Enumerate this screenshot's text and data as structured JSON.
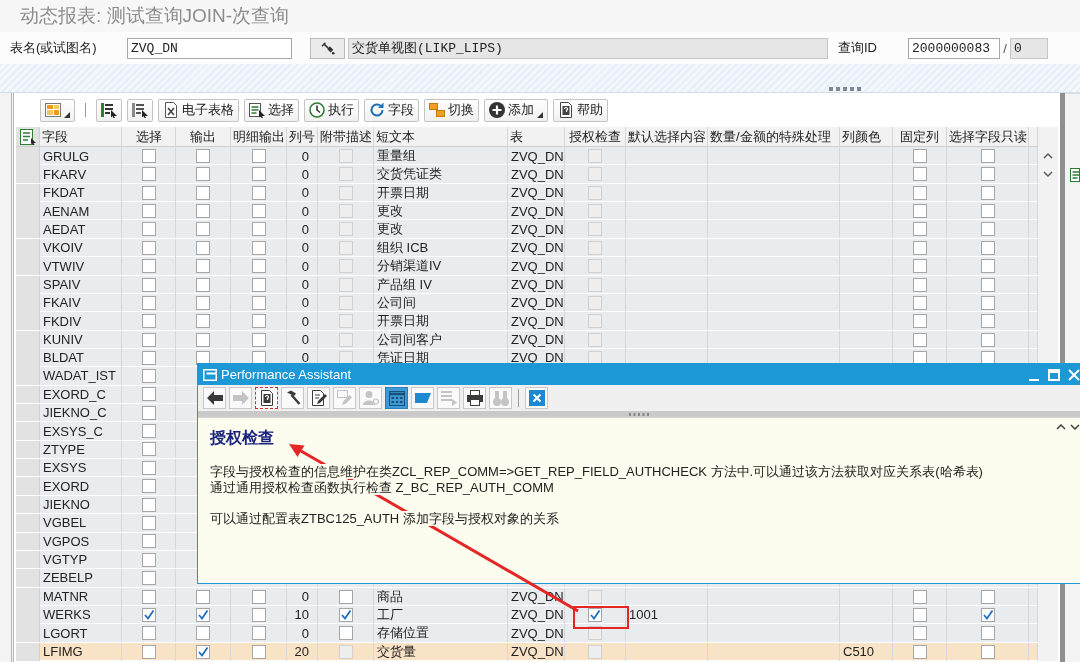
{
  "page_title": "动态报表: 测试查询JOIN-次查询",
  "header_fields": {
    "table_name": {
      "label": "表名(或试图名)",
      "value": "ZVQ_DN"
    },
    "table_description": "交货单视图(LIKP_LIPS)",
    "query_id": {
      "label": "查询ID",
      "value": "2000000083",
      "separator": "/",
      "sub_value": "0"
    }
  },
  "toolbar": [
    {
      "kind": "button",
      "menu": true
    },
    {
      "kind": "separator"
    },
    {
      "kind": "button",
      "menu": false
    },
    {
      "kind": "button",
      "menu": false
    },
    {
      "kind": "button",
      "label": "电子表格",
      "menu": false
    },
    {
      "kind": "button",
      "label": "选择",
      "menu": false
    },
    {
      "kind": "button",
      "label": "执行",
      "menu": false
    },
    {
      "kind": "button",
      "label": "字段",
      "menu": false
    },
    {
      "kind": "button",
      "label": "切换",
      "menu": false
    },
    {
      "kind": "button",
      "label": "添加",
      "menu": true
    },
    {
      "kind": "button",
      "label": "帮助",
      "menu": false
    }
  ],
  "table": {
    "columns": [
      {
        "label": "字段",
        "kind": "text"
      },
      {
        "label": "选择",
        "kind": "check"
      },
      {
        "label": "输出",
        "kind": "check"
      },
      {
        "label": "明细输出",
        "kind": "check"
      },
      {
        "label": "列号",
        "kind": "number"
      },
      {
        "label": "附带描述",
        "kind": "check"
      },
      {
        "label": "短文本",
        "kind": "text"
      },
      {
        "label": "表",
        "kind": "text"
      },
      {
        "label": "授权检查",
        "kind": "check"
      },
      {
        "label": "默认选择内容",
        "kind": "text"
      },
      {
        "label": "数量/金额的特殊处理",
        "kind": "text"
      },
      {
        "label": "列颜色",
        "kind": "text"
      },
      {
        "label": "固定列",
        "kind": "check"
      },
      {
        "label": "选择字段只读",
        "kind": "check"
      }
    ],
    "rows": [
      {
        "highlighted": false,
        "cells": [
          "GRULG",
          {
            "checked": false,
            "disabled": false
          },
          {
            "checked": false,
            "disabled": false
          },
          {
            "checked": false,
            "disabled": false
          },
          "0",
          {
            "checked": false,
            "disabled": true
          },
          "重量组",
          "ZVQ_DN",
          {
            "checked": false,
            "disabled": true
          },
          null,
          null,
          null,
          {
            "checked": false,
            "disabled": false
          },
          {
            "checked": false,
            "disabled": false
          }
        ]
      },
      {
        "highlighted": false,
        "cells": [
          "FKARV",
          {
            "checked": false,
            "disabled": false
          },
          {
            "checked": false,
            "disabled": false
          },
          {
            "checked": false,
            "disabled": false
          },
          "0",
          {
            "checked": false,
            "disabled": true
          },
          "交货凭证类",
          "ZVQ_DN",
          {
            "checked": false,
            "disabled": true
          },
          null,
          null,
          null,
          {
            "checked": false,
            "disabled": false
          },
          {
            "checked": false,
            "disabled": false
          }
        ]
      },
      {
        "highlighted": false,
        "cells": [
          "FKDAT",
          {
            "checked": false,
            "disabled": false
          },
          {
            "checked": false,
            "disabled": false
          },
          {
            "checked": false,
            "disabled": false
          },
          "0",
          {
            "checked": false,
            "disabled": true
          },
          "开票日期",
          "ZVQ_DN",
          {
            "checked": false,
            "disabled": true
          },
          null,
          null,
          null,
          {
            "checked": false,
            "disabled": false
          },
          {
            "checked": false,
            "disabled": false
          }
        ]
      },
      {
        "highlighted": false,
        "cells": [
          "AENAM",
          {
            "checked": false,
            "disabled": false
          },
          {
            "checked": false,
            "disabled": false
          },
          {
            "checked": false,
            "disabled": false
          },
          "0",
          {
            "checked": false,
            "disabled": true
          },
          "更改",
          "ZVQ_DN",
          {
            "checked": false,
            "disabled": true
          },
          null,
          null,
          null,
          {
            "checked": false,
            "disabled": false
          },
          {
            "checked": false,
            "disabled": false
          }
        ]
      },
      {
        "highlighted": false,
        "cells": [
          "AEDAT",
          {
            "checked": false,
            "disabled": false
          },
          {
            "checked": false,
            "disabled": false
          },
          {
            "checked": false,
            "disabled": false
          },
          "0",
          {
            "checked": false,
            "disabled": true
          },
          "更改",
          "ZVQ_DN",
          {
            "checked": false,
            "disabled": true
          },
          null,
          null,
          null,
          {
            "checked": false,
            "disabled": false
          },
          {
            "checked": false,
            "disabled": false
          }
        ]
      },
      {
        "highlighted": false,
        "cells": [
          "VKOIV",
          {
            "checked": false,
            "disabled": false
          },
          {
            "checked": false,
            "disabled": false
          },
          {
            "checked": false,
            "disabled": false
          },
          "0",
          {
            "checked": false,
            "disabled": true
          },
          "组织 ICB",
          "ZVQ_DN",
          {
            "checked": false,
            "disabled": true
          },
          null,
          null,
          null,
          {
            "checked": false,
            "disabled": false
          },
          {
            "checked": false,
            "disabled": false
          }
        ]
      },
      {
        "highlighted": false,
        "cells": [
          "VTWIV",
          {
            "checked": false,
            "disabled": false
          },
          {
            "checked": false,
            "disabled": false
          },
          {
            "checked": false,
            "disabled": false
          },
          "0",
          {
            "checked": false,
            "disabled": true
          },
          "分销渠道IV",
          "ZVQ_DN",
          {
            "checked": false,
            "disabled": true
          },
          null,
          null,
          null,
          {
            "checked": false,
            "disabled": false
          },
          {
            "checked": false,
            "disabled": false
          }
        ]
      },
      {
        "highlighted": false,
        "cells": [
          "SPAIV",
          {
            "checked": false,
            "disabled": false
          },
          {
            "checked": false,
            "disabled": false
          },
          {
            "checked": false,
            "disabled": false
          },
          "0",
          {
            "checked": false,
            "disabled": true
          },
          "产品组 IV",
          "ZVQ_DN",
          {
            "checked": false,
            "disabled": true
          },
          null,
          null,
          null,
          {
            "checked": false,
            "disabled": false
          },
          {
            "checked": false,
            "disabled": false
          }
        ]
      },
      {
        "highlighted": false,
        "cells": [
          "FKAIV",
          {
            "checked": false,
            "disabled": false
          },
          {
            "checked": false,
            "disabled": false
          },
          {
            "checked": false,
            "disabled": false
          },
          "0",
          {
            "checked": false,
            "disabled": true
          },
          "公司间",
          "ZVQ_DN",
          {
            "checked": false,
            "disabled": true
          },
          null,
          null,
          null,
          {
            "checked": false,
            "disabled": false
          },
          {
            "checked": false,
            "disabled": false
          }
        ]
      },
      {
        "highlighted": false,
        "cells": [
          "FKDIV",
          {
            "checked": false,
            "disabled": false
          },
          {
            "checked": false,
            "disabled": false
          },
          {
            "checked": false,
            "disabled": false
          },
          "0",
          {
            "checked": false,
            "disabled": true
          },
          "开票日期",
          "ZVQ_DN",
          {
            "checked": false,
            "disabled": true
          },
          null,
          null,
          null,
          {
            "checked": false,
            "disabled": false
          },
          {
            "checked": false,
            "disabled": false
          }
        ]
      },
      {
        "highlighted": false,
        "cells": [
          "KUNIV",
          {
            "checked": false,
            "disabled": false
          },
          {
            "checked": false,
            "disabled": false
          },
          {
            "checked": false,
            "disabled": false
          },
          "0",
          {
            "checked": false,
            "disabled": true
          },
          "公司间客户",
          "ZVQ_DN",
          {
            "checked": false,
            "disabled": true
          },
          null,
          null,
          null,
          {
            "checked": false,
            "disabled": false
          },
          {
            "checked": false,
            "disabled": false
          }
        ]
      },
      {
        "highlighted": false,
        "cells": [
          "BLDAT",
          {
            "checked": false,
            "disabled": false
          },
          {
            "checked": false,
            "disabled": false
          },
          {
            "checked": false,
            "disabled": false
          },
          "0",
          {
            "checked": false,
            "disabled": true
          },
          "凭证日期",
          "ZVQ_DN",
          {
            "checked": false,
            "disabled": true
          },
          null,
          null,
          null,
          {
            "checked": false,
            "disabled": false
          },
          {
            "checked": false,
            "disabled": false
          }
        ]
      },
      {
        "highlighted": false,
        "cells": [
          "WADAT_IST",
          {
            "checked": false,
            "disabled": false
          }
        ]
      },
      {
        "highlighted": false,
        "cells": [
          "EXORD_C",
          {
            "checked": false,
            "disabled": false
          }
        ]
      },
      {
        "highlighted": false,
        "cells": [
          "JIEKNO_C",
          {
            "checked": false,
            "disabled": false
          }
        ]
      },
      {
        "highlighted": false,
        "cells": [
          "EXSYS_C",
          {
            "checked": false,
            "disabled": false
          }
        ]
      },
      {
        "highlighted": false,
        "cells": [
          "ZTYPE",
          {
            "checked": false,
            "disabled": false
          }
        ]
      },
      {
        "highlighted": false,
        "cells": [
          "EXSYS",
          {
            "checked": false,
            "disabled": false
          }
        ]
      },
      {
        "highlighted": false,
        "cells": [
          "EXORD",
          {
            "checked": false,
            "disabled": false
          }
        ]
      },
      {
        "highlighted": false,
        "cells": [
          "JIEKNO",
          {
            "checked": false,
            "disabled": false
          }
        ]
      },
      {
        "highlighted": false,
        "cells": [
          "VGBEL",
          {
            "checked": false,
            "disabled": false
          }
        ]
      },
      {
        "highlighted": false,
        "cells": [
          "VGPOS",
          {
            "checked": false,
            "disabled": false
          }
        ]
      },
      {
        "highlighted": false,
        "cells": [
          "VGTYP",
          {
            "checked": false,
            "disabled": false
          }
        ]
      },
      {
        "highlighted": false,
        "cells": [
          "ZEBELP",
          {
            "checked": false,
            "disabled": false
          }
        ]
      },
      {
        "highlighted": false,
        "cells": [
          "MATNR",
          {
            "checked": false,
            "disabled": false
          },
          {
            "checked": false,
            "disabled": false
          },
          {
            "checked": false,
            "disabled": false
          },
          "0",
          {
            "checked": false,
            "disabled": false
          },
          "商品",
          "ZVQ_DN",
          {
            "checked": false,
            "disabled": true
          },
          null,
          null,
          null,
          {
            "checked": false,
            "disabled": false
          },
          {
            "checked": false,
            "disabled": false
          }
        ]
      },
      {
        "highlighted": false,
        "cells": [
          "WERKS",
          {
            "checked": true,
            "disabled": false
          },
          {
            "checked": true,
            "disabled": false
          },
          {
            "checked": false,
            "disabled": false
          },
          "10",
          {
            "checked": true,
            "disabled": false
          },
          "工厂",
          "ZVQ_DN",
          {
            "checked": true,
            "disabled": false
          },
          "1001",
          null,
          null,
          {
            "checked": false,
            "disabled": false
          },
          {
            "checked": true,
            "disabled": false
          }
        ]
      },
      {
        "highlighted": false,
        "cells": [
          "LGORT",
          {
            "checked": false,
            "disabled": false
          },
          {
            "checked": false,
            "disabled": false
          },
          {
            "checked": false,
            "disabled": false
          },
          "0",
          {
            "checked": false,
            "disabled": false
          },
          "存储位置",
          "ZVQ_DN",
          {
            "checked": false,
            "disabled": true
          },
          null,
          null,
          null,
          {
            "checked": false,
            "disabled": false
          },
          {
            "checked": false,
            "disabled": false
          }
        ]
      },
      {
        "highlighted": true,
        "cells": [
          "LFIMG",
          {
            "checked": false,
            "disabled": false
          },
          {
            "checked": true,
            "disabled": false
          },
          {
            "checked": false,
            "disabled": false
          },
          "20",
          {
            "checked": false,
            "disabled": true
          },
          "交货量",
          "ZVQ_DN",
          {
            "checked": false,
            "disabled": true
          },
          null,
          null,
          "C510",
          {
            "checked": false,
            "disabled": false
          },
          {
            "checked": false,
            "disabled": false
          }
        ]
      }
    ]
  },
  "popup": {
    "title": "Performance Assistant",
    "toolbar": [
      {
        "kind": "button",
        "disabled": false,
        "selected": false,
        "focused": false
      },
      {
        "kind": "button",
        "disabled": true,
        "selected": false,
        "focused": false
      },
      {
        "kind": "button",
        "disabled": false,
        "selected": false,
        "focused": true
      },
      {
        "kind": "button",
        "disabled": false,
        "selected": false,
        "focused": false
      },
      {
        "kind": "button",
        "disabled": false,
        "selected": false,
        "focused": false
      },
      {
        "kind": "button",
        "disabled": true,
        "selected": false,
        "focused": false
      },
      {
        "kind": "button",
        "disabled": true,
        "selected": false,
        "focused": false
      },
      {
        "kind": "button",
        "disabled": false,
        "selected": true,
        "focused": false
      },
      {
        "kind": "button",
        "disabled": false,
        "selected": false,
        "focused": false
      },
      {
        "kind": "button",
        "disabled": true,
        "selected": false,
        "focused": false
      },
      {
        "kind": "button",
        "disabled": false,
        "selected": false,
        "focused": false
      },
      {
        "kind": "button",
        "disabled": true,
        "selected": false,
        "focused": false
      },
      {
        "kind": "separator"
      },
      {
        "kind": "button",
        "disabled": false,
        "selected": false,
        "focused": false
      }
    ],
    "heading": "授权检查",
    "paragraphs": [
      [
        "字段与授权检查的信息维护在类ZCL_REP_COMM=>GET_REP_FIELD_AUTHCHECK 方法中.可以通过该方法获取对应关系表(哈希表)",
        "通过通用授权检查函数执行检查 Z_BC_REP_AUTH_COMM"
      ],
      [
        "可以通过配置表ZTBC125_AUTH 添加字段与授权对象的关系"
      ]
    ]
  }
}
